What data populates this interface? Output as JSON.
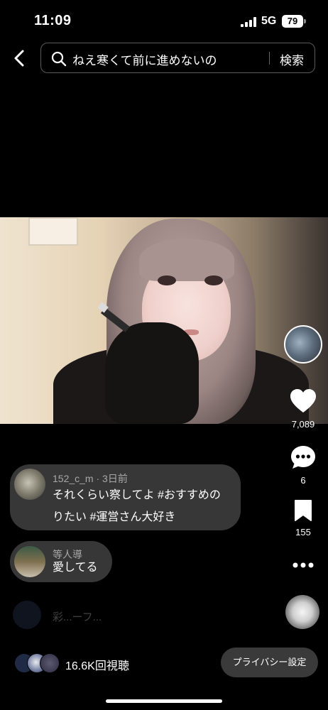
{
  "status_bar": {
    "time": "11:09",
    "network": "5G",
    "battery": "79"
  },
  "search": {
    "query": "ねえ寒くて前に進めないの",
    "submit_label": "検索"
  },
  "actions": {
    "likes": "7,089",
    "comments": "6",
    "saves": "155"
  },
  "comments": [
    {
      "user": "152_c_m",
      "time": "3日前",
      "separator": "·",
      "line1": "それくらい察してよ #おすすめの",
      "line2": "りたい #運営さん大好き"
    },
    {
      "user": "等人導",
      "text": "愛してる"
    }
  ],
  "faded_comment": "彩...ーフ...",
  "viewers": {
    "count": "16.6K回視聴"
  },
  "privacy_button": "プライバシー設定",
  "icons": {
    "back": "chevron-left-icon",
    "search": "search-icon",
    "like": "heart-icon",
    "comment": "comment-bubble-icon",
    "save": "bookmark-icon",
    "more": "more-dots-icon"
  }
}
